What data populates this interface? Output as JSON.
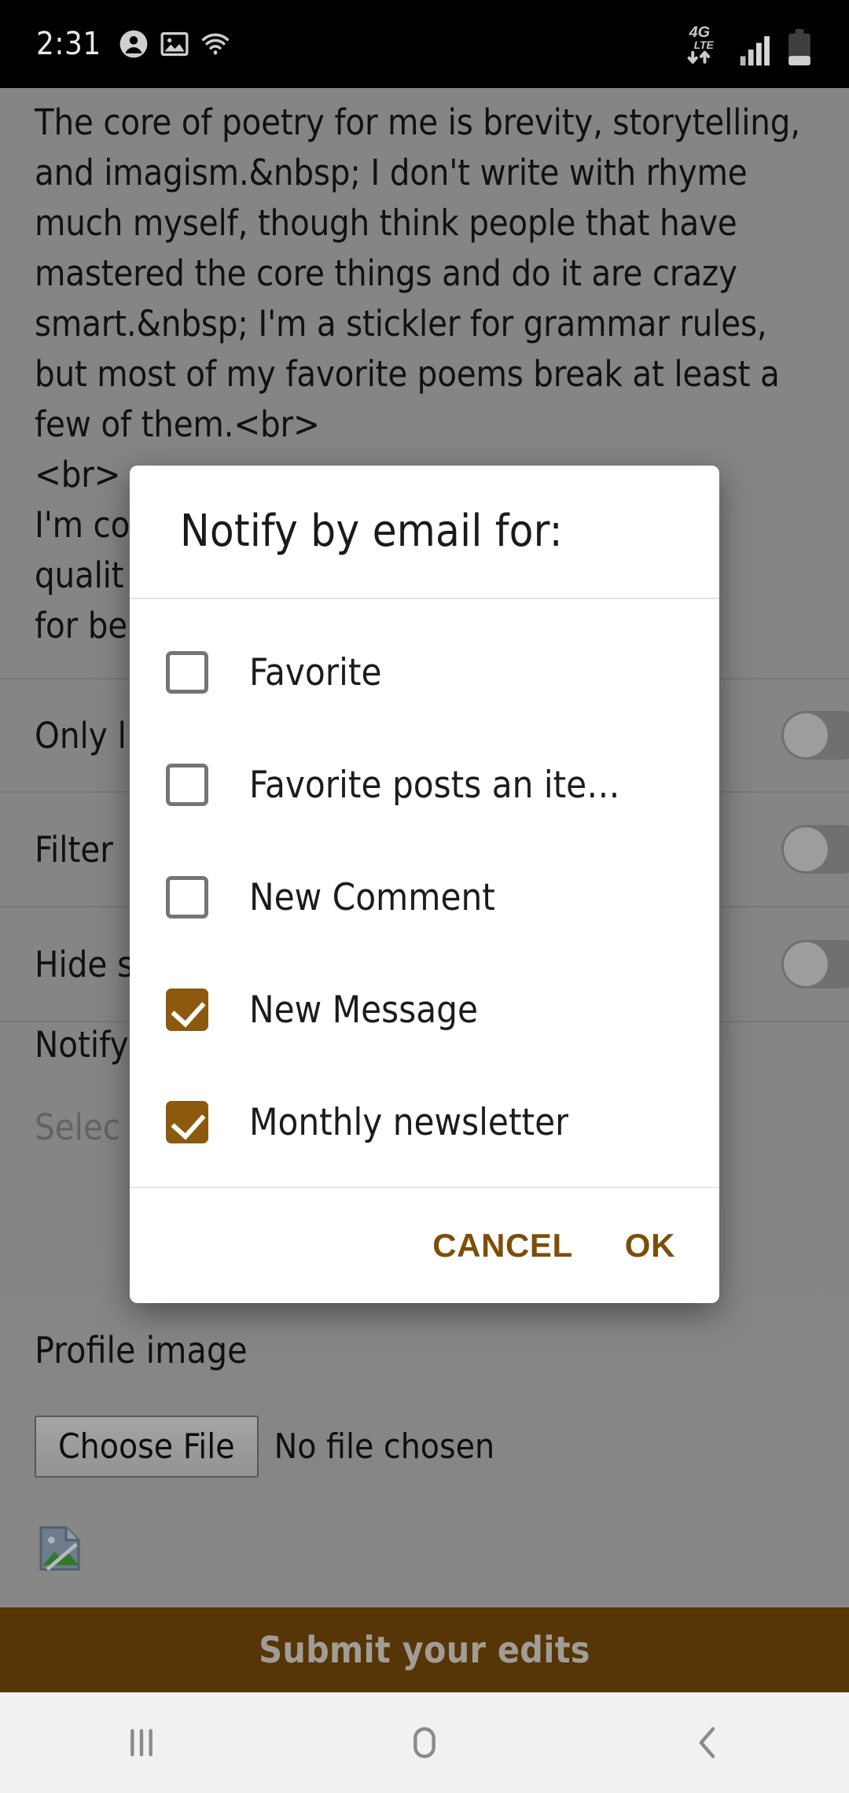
{
  "statusbar": {
    "time": "2:31",
    "left_icons": [
      "account-circle-icon",
      "image-icon",
      "wifi-icon"
    ],
    "right_icons": [
      "4g-lte-data-icon",
      "signal-bars-icon",
      "battery-icon"
    ],
    "network_label": "4G",
    "network_sub": "LTE"
  },
  "page": {
    "body_text": "The core of poetry for me is brevity, storytelling, and imagism.&nbsp; I don't write with rhyme much myself, though think people that have mastered the core things and do it are crazy smart.&nbsp; I'm a stickler for grammar rules, but most of my favorite poems break at least a few of them.<br><br>I'm co                    s qualit                nks for be",
    "settings_rows": [
      {
        "label": "Only l",
        "toggle": "off"
      },
      {
        "label": "Filter",
        "toggle": "off"
      },
      {
        "label": "Hide s",
        "toggle": "off"
      }
    ],
    "notify": {
      "label": "Notify",
      "select_placeholder": "Selec"
    },
    "profile": {
      "label": "Profile image",
      "choose_file_label": "Choose File",
      "no_file_label": "No file chosen",
      "thumbnail_icon": "broken-image-icon"
    },
    "submit_label": "Submit your edits"
  },
  "dialog": {
    "title": "Notify by email for:",
    "options": [
      {
        "label": "Favorite",
        "checked": false
      },
      {
        "label": "Favorite posts an ite…",
        "checked": false
      },
      {
        "label": "New Comment",
        "checked": false
      },
      {
        "label": "New Message",
        "checked": true
      },
      {
        "label": "Monthly newsletter",
        "checked": true
      }
    ],
    "cancel_label": "CANCEL",
    "ok_label": "OK",
    "accent_color": "#8b5a0e"
  },
  "navbar": {
    "recents_label": "recents-icon",
    "home_label": "home-icon",
    "back_label": "back-icon"
  }
}
